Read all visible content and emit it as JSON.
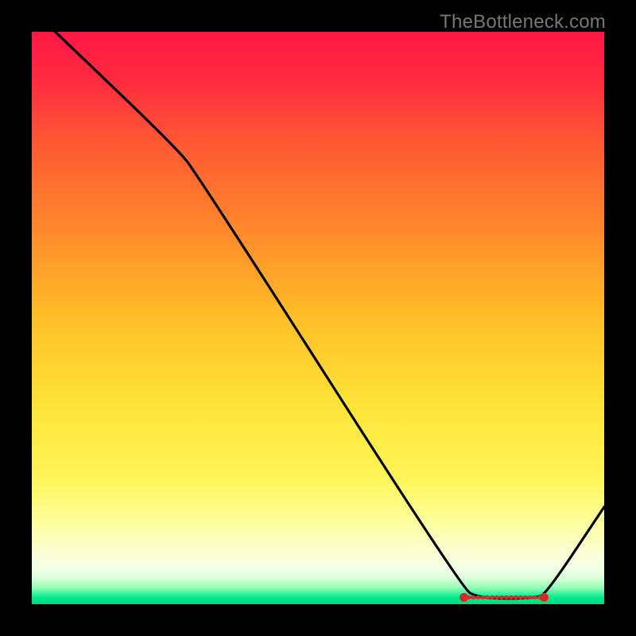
{
  "watermark": "TheBottleneck.com",
  "chart_data": {
    "type": "line",
    "title": "",
    "xlabel": "",
    "ylabel": "",
    "x_range": [
      0,
      100
    ],
    "y_range": [
      0,
      100
    ],
    "background_gradient": {
      "stops": [
        {
          "offset": 0.0,
          "color": "#ff1744"
        },
        {
          "offset": 0.08,
          "color": "#ff2a3f"
        },
        {
          "offset": 0.2,
          "color": "#ff5a33"
        },
        {
          "offset": 0.35,
          "color": "#ff8a2b"
        },
        {
          "offset": 0.5,
          "color": "#ffbf28"
        },
        {
          "offset": 0.65,
          "color": "#ffe338"
        },
        {
          "offset": 0.78,
          "color": "#fff55a"
        },
        {
          "offset": 0.86,
          "color": "#fdffa0"
        },
        {
          "offset": 0.905,
          "color": "#fbffd0"
        },
        {
          "offset": 0.935,
          "color": "#f6ffe7"
        },
        {
          "offset": 0.955,
          "color": "#d9ffd9"
        },
        {
          "offset": 0.972,
          "color": "#8dffb4"
        },
        {
          "offset": 0.988,
          "color": "#00ea8e"
        },
        {
          "offset": 1.0,
          "color": "#00d87d"
        }
      ]
    },
    "series": [
      {
        "name": "curve",
        "points": [
          {
            "x": 2,
            "y": 102
          },
          {
            "x": 25,
            "y": 80
          },
          {
            "x": 29,
            "y": 75
          },
          {
            "x": 75,
            "y": 3
          },
          {
            "x": 78,
            "y": 1
          },
          {
            "x": 88,
            "y": 1
          },
          {
            "x": 90,
            "y": 2
          },
          {
            "x": 100,
            "y": 17
          }
        ]
      }
    ],
    "markers": {
      "y": 1.2,
      "x_start": 75.5,
      "x_end": 89.5,
      "count_small": 16,
      "end_caps": true
    }
  }
}
